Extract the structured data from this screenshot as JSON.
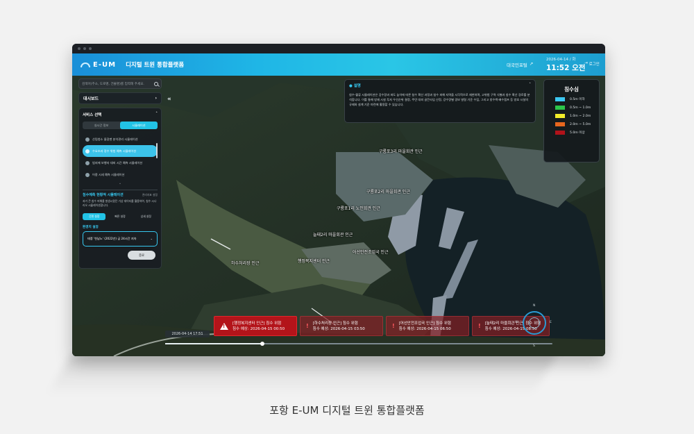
{
  "window": {
    "app_logo": "E-UM",
    "app_title": "디지털 트윈 통합플랫폼"
  },
  "header": {
    "portal_link": "대국민포털",
    "date": "2026-04-14 / 화",
    "time": "11:52 오전",
    "logout": "로그인"
  },
  "sidebar": {
    "search_placeholder": "검색어(주소, 도로명, 건물명)를 입력해 주세요.",
    "dashboard": "대시보드",
    "service_title": "서비스 선택",
    "tabs": [
      "실시간 정보",
      "시뮬레이션"
    ],
    "services": [
      "산림청소 물광맨 분석관리 시뮬레이션",
      "수요초과 정수 위험 예측 시뮬레이션",
      "범죄에 보행자 대피 시간 예측 시뮬레이션",
      "어종 시세 예측 시뮬레이션"
    ],
    "flood_title": "침수예측 현황적 시뮬레이션",
    "flood_meta": "관리지표 설정",
    "flood_desc": "과거 큰 침수 피해를 발생시켰던 기상 데이터를 활용하여, 침수 시나리오 시뮬레이션합니다.",
    "modes": [
      "간편 설정",
      "빠른 설정",
      "상세 설정"
    ],
    "condition_label": "환경치 설정",
    "condition_value": "태풍 '힌남노' (2022년) 급 24시간 지속",
    "end_button": "종료"
  },
  "info_panel": {
    "title": "설명",
    "body": "침수-월류 시뮬레이션은 강수량과 파도 높이에 따른 침수 확산 과정과 침수 피해 지역을 시각적으로 재현하며, 고위험 구역 식별과 침수 확산 경로를 분석합니다. 이를 통해 방재 시설 투자 우선순위 결정, 주민 대피 골든타임 산정, 강수량별 경보 발령 기준 수립, 그리고 방수벽·배수펌프 등 방호 시설의 규제와 설계 기준 마련에 활용할 수 있습니다."
  },
  "legend": {
    "title": "침수심",
    "items": [
      {
        "label": "0.5m 이하",
        "color": "#3cc8f2"
      },
      {
        "label": "0.5m ~ 1.0m",
        "color": "#2cc64a"
      },
      {
        "label": "1.0m ~ 2.0m",
        "color": "#f2ec2a"
      },
      {
        "label": "2.0m ~ 5.0m",
        "color": "#e6661e"
      },
      {
        "label": "5.0m 이상",
        "color": "#b0121a"
      }
    ]
  },
  "map_labels": [
    "구룡포3리 마을회관 인근",
    "구룡포2리 마을회관 인근",
    "구룡포1리 노인회관 인근",
    "늘태2리 마을회관 인근",
    "어선안전조업국 인근",
    "하수처리장 인근",
    "행정복지센터 인근"
  ],
  "alerts": [
    {
      "title": "[행정복지센터 인근] 침수 위험",
      "eta": "침수 예상: 2026-04-15 00:50"
    },
    {
      "title": "[하수처리장 인근] 침수 위험",
      "eta": "침수 예상: 2026-04-15 03:50"
    },
    {
      "title": "[어선안전조업국 인근] 침수 위험",
      "eta": "침수 예상: 2026-04-15 06:50"
    },
    {
      "title": "[늘태2리 마을회관 인근] 침수 위험",
      "eta": "침수 예상: 2026-04-15 08:50"
    }
  ],
  "timeline": {
    "current": "2026-04-14 17:51",
    "progress": 0.25
  },
  "compass": {
    "n": "N",
    "s": "S",
    "e": "E",
    "w": "W"
  },
  "caption": "포항 E-UM 디지털 트윈 통합플랫폼"
}
